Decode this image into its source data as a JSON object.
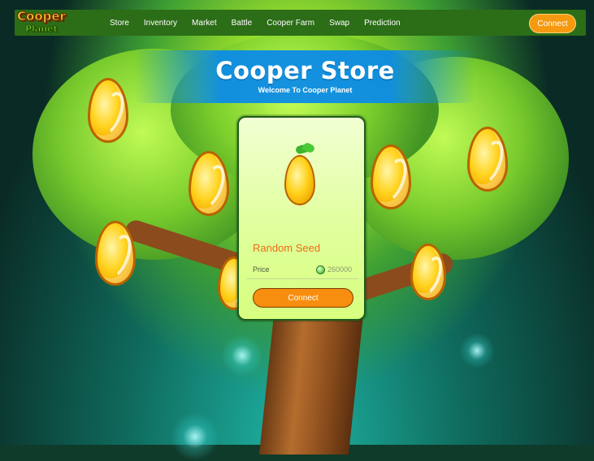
{
  "app": {
    "logo": {
      "top": "Cooper",
      "bottom": "Planet"
    }
  },
  "nav": {
    "items": [
      "Store",
      "Inventory",
      "Market",
      "Battle",
      "Cooper Farm",
      "Swap",
      "Prediction"
    ],
    "connect_label": "Connect"
  },
  "banner": {
    "title": "Cooper Store",
    "subtitle": "Welcome To Cooper Planet"
  },
  "store_item": {
    "name": "Random Seed",
    "price_label": "Price",
    "price_value": "260000",
    "price_icon": "coin-icon",
    "action_label": "Connect"
  },
  "colors": {
    "nav_bg": "#2c6d17",
    "accent_orange": "#f88e0f",
    "banner_blue": "#0c8ce6",
    "card_bg": "#e0ff9c"
  }
}
